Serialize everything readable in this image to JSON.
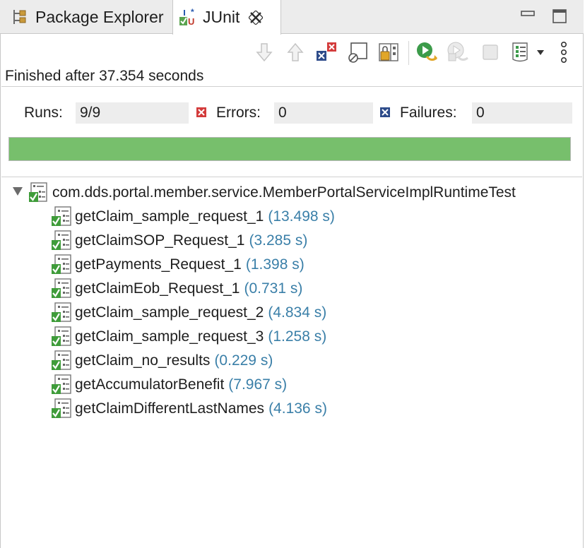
{
  "tabs": [
    {
      "label": "Package Explorer",
      "icon": "package-explorer-icon"
    },
    {
      "label": "JUnit",
      "icon": "junit-icon"
    }
  ],
  "toolbar": {
    "buttons": [
      "next-failure-icon",
      "previous-failure-icon",
      "failures-only-icon",
      "scroll-lock-icon",
      "layout-icon",
      "rerun-icon",
      "rerun-failed-icon",
      "stop-icon",
      "history-icon",
      "view-menu-icon"
    ]
  },
  "status": "Finished after 37.354 seconds",
  "counters": {
    "runs_label": "Runs:",
    "runs_value": "9/9",
    "errors_label": "Errors:",
    "errors_value": "0",
    "failures_label": "Failures:",
    "failures_value": "0"
  },
  "progress": {
    "fraction": 1.0,
    "color": "#77bf6c"
  },
  "tree": {
    "suite": "com.dds.portal.member.service.MemberPortalServiceImplRuntimeTest",
    "tests": [
      {
        "name": "getClaim_sample_request_1",
        "time": "(13.498 s)"
      },
      {
        "name": "getClaimSOP_Request_1",
        "time": "(3.285 s)"
      },
      {
        "name": "getPayments_Request_1",
        "time": "(1.398 s)"
      },
      {
        "name": "getClaimEob_Request_1",
        "time": "(0.731 s)"
      },
      {
        "name": "getClaim_sample_request_2",
        "time": "(4.834 s)"
      },
      {
        "name": "getClaim_sample_request_3",
        "time": "(1.258 s)"
      },
      {
        "name": "getClaim_no_results",
        "time": "(0.229 s)"
      },
      {
        "name": "getAccumulatorBenefit",
        "time": "(7.967 s)"
      },
      {
        "name": "getClaimDifferentLastNames",
        "time": "(4.136 s)"
      }
    ]
  },
  "colors": {
    "time_text": "#3a7fa8",
    "pass_green": "#3f9c3a",
    "error_red": "#d33b3b",
    "failure_blue": "#2d4b8a"
  }
}
